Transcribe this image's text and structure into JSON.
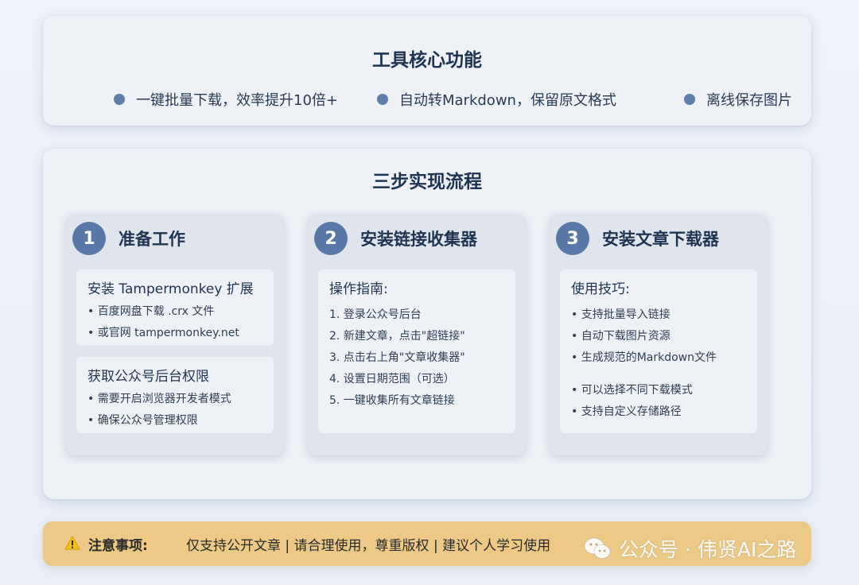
{
  "core": {
    "title": "工具核心功能",
    "features": [
      "一键批量下载，效率提升10倍+",
      "自动转Markdown，保留原文格式",
      "离线保存图片"
    ]
  },
  "flow": {
    "title": "三步实现流程",
    "steps": [
      {
        "num": "1",
        "title": "准备工作",
        "boxes": [
          {
            "title": "安装 Tampermonkey 扩展",
            "items": [
              "• 百度网盘下载 .crx 文件",
              "• 或官网 tampermonkey.net"
            ]
          },
          {
            "title": "获取公众号后台权限",
            "items": [
              "• 需要开启浏览器开发者模式",
              "• 确保公众号管理权限"
            ]
          }
        ]
      },
      {
        "num": "2",
        "title": "安装链接收集器",
        "boxes": [
          {
            "title": "操作指南:",
            "items": [
              "1. 登录公众号后台",
              "2. 新建文章，点击\"超链接\"",
              "3. 点击右上角\"文章收集器\"",
              "4. 设置日期范围（可选）",
              "5. 一键收集所有文章链接"
            ]
          }
        ]
      },
      {
        "num": "3",
        "title": "安装文章下载器",
        "boxes": [
          {
            "title": "使用技巧:",
            "items": [
              "• 支持批量导入链接",
              "• 自动下载图片资源",
              "• 生成规范的Markdown文件",
              "• 可以选择不同下载模式",
              "• 支持自定义存储路径"
            ]
          }
        ]
      }
    ]
  },
  "notice": {
    "label": "注意事项:",
    "text": "仅支持公开文章 | 请合理使用，尊重版权 | 建议个人学习使用"
  },
  "watermark": {
    "text": "公众号 · 伟贤AI之路"
  },
  "colors": {
    "accent": "#5878a8",
    "notice_bg": "#ecc987",
    "card_bg": "#eef1f6",
    "step_bg": "#dfe4ed"
  },
  "icons": {
    "feature_bullet": "dot-icon",
    "notice": "warning-icon",
    "watermark": "wechat-icon"
  }
}
